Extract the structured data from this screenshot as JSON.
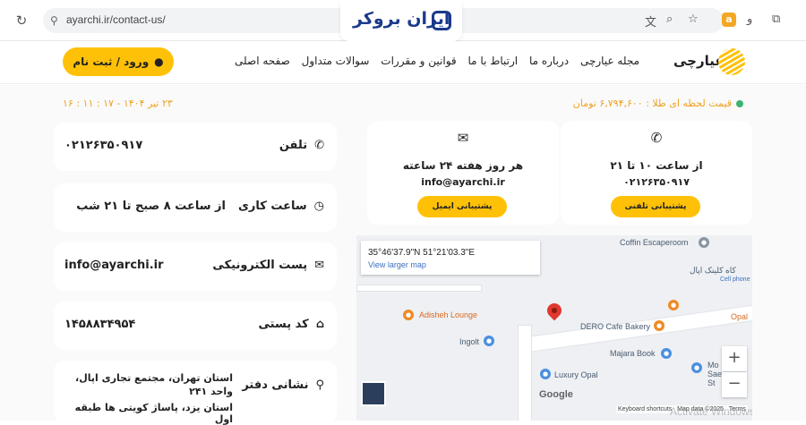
{
  "browser": {
    "url": "ayarchi.ir/contact-us/",
    "brand_name": "ایران بروکر"
  },
  "header": {
    "login_label": "ورود / ثبت نام",
    "menu": [
      "صفحه اصلی",
      "سوالات متداول",
      "قوانین و مقررات",
      "ارتباط با ما",
      "درباره ما",
      "مجله عیارچی"
    ],
    "logo_text": "عیارچی"
  },
  "topline": {
    "gold_price": "قیمت لحظه ای طلا : ۶,۷۹۴,۶۰۰ تومان",
    "date": "۲۳ تیر ۱۴۰۴ - ۱۷ : ۱۱ : ۱۶"
  },
  "contacts": [
    {
      "label": "تلفن",
      "value": "۰۲۱۲۶۳۵۰۹۱۷",
      "icon": "phone-icon"
    },
    {
      "label": "ساعت کاری",
      "value": "از ساعت ۸ صبح تا ۲۱ شب",
      "icon": "clock-icon"
    },
    {
      "label": "پست الکترونیکی",
      "value": "info@ayarchi.ir",
      "icon": "envelope-open-icon"
    },
    {
      "label": "کد پستی",
      "value": "۱۴۵۸۸۳۴۹۵۴",
      "icon": "inbox-icon"
    },
    {
      "label": "نشانی دفتر",
      "value": "استان تهران، مجتمع تجاری اپال، واحد ۲۴۱",
      "value2": "استان یزد، پاساژ کویتی ها طبقه اول",
      "icon": "map-pin-icon"
    }
  ],
  "support": [
    {
      "title": "از ساعت ۱۰ تا ۲۱",
      "sub": "۰۲۱۲۶۳۵۰۹۱۷",
      "button": "پشتیبانی تلفنی",
      "icon": "phone-icon"
    },
    {
      "title": "هر روز هفته ۲۴ ساعته",
      "sub": "info@ayarchi.ir",
      "button": "پشتیبانی ایمیل",
      "icon": "envelope-icon"
    }
  ],
  "map": {
    "coords": "35°46'37.9\"N 51°21'03.3\"E",
    "larger_link": "View larger map",
    "labels": {
      "coffin": "Coffin Escaperoom",
      "opal_clinic": "کاه کلینک اپال",
      "cell_phone": "Cell phone",
      "adisheh": "Adisheh Lounge",
      "dero": "DERO Cafe Bakery",
      "opal": "Opal",
      "ingolt": "Ingolt",
      "majara": "Majara Book",
      "luxury": "Luxury Opal",
      "mo": "Mo",
      "sae": "Sae",
      "st": "St",
      "google": "Google",
      "shortcuts": "Keyboard shortcuts",
      "mapdata": "Map data ©2025",
      "terms": "Terms"
    },
    "watermark": "Activate Windows"
  }
}
